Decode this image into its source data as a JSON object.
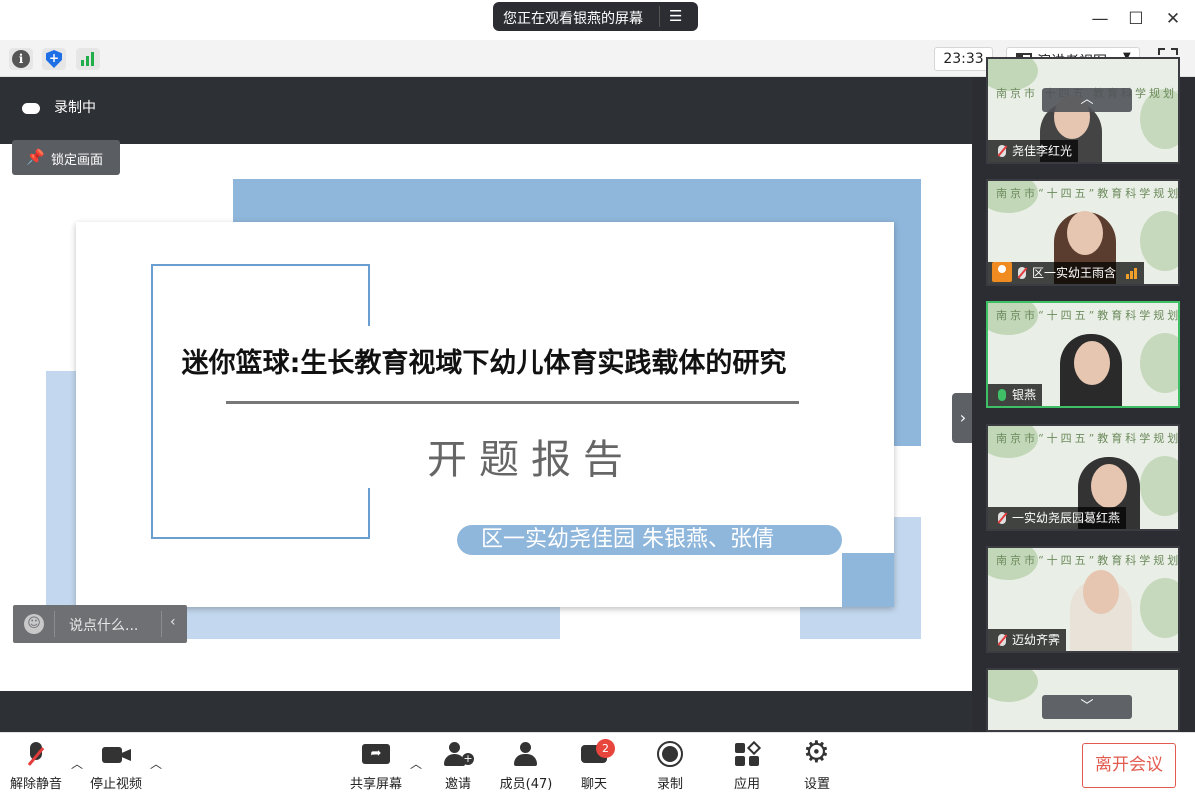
{
  "titlebar": {
    "sharing_notice": "您正在观看银燕的屏幕",
    "menu_icon": "list-menu-icon",
    "controls": [
      "minimize-icon",
      "maximize-icon",
      "close-icon"
    ]
  },
  "toolbar": {
    "icons": [
      "info-icon",
      "security-shield-icon",
      "signal-icon"
    ],
    "time": "23:33",
    "view_mode": "演讲者视图",
    "fullscreen_icon": "fullscreen-icon"
  },
  "share": {
    "recording_label": "录制中",
    "lock_label": "锁定画面",
    "chat_placeholder": "说点什么..."
  },
  "slide": {
    "title": "迷你篮球:生长教育视域下幼儿体育实践载体的研究",
    "subtitle": "开题报告",
    "authors": "区一实幼尧佳园   朱银燕、张倩"
  },
  "participants": [
    {
      "name": "尧佳李红光",
      "muted": true,
      "banner": "南京市 十四五 教育科学规划课题"
    },
    {
      "name": "区一实幼王雨含",
      "muted": true,
      "banner": "南京市“十四五”教育科学规划课题",
      "avatar": true,
      "signal": true
    },
    {
      "name": "银燕",
      "muted": false,
      "active": true,
      "banner": "南京市“十四五”教育科学规划课题"
    },
    {
      "name": "一实幼尧辰园葛红燕",
      "muted": true,
      "banner": "南京市“十四五”教育科学规划课题"
    },
    {
      "name": "迈幼齐霁",
      "muted": true,
      "banner": "南京市“十四五”教育科学规划课题"
    }
  ],
  "bottom": {
    "unmute": "解除静音",
    "stop_video": "停止视频",
    "share_screen": "共享屏幕",
    "invite": "邀请",
    "members": "成员(47)",
    "chat": "聊天",
    "chat_badge": "2",
    "record": "录制",
    "apps": "应用",
    "settings": "设置",
    "leave": "离开会议"
  },
  "colors": {
    "accent_blue": "#8fb6db",
    "leave_red": "#e25b4f",
    "active_green": "#3fbf66",
    "panel_dark": "#2b2d33"
  }
}
